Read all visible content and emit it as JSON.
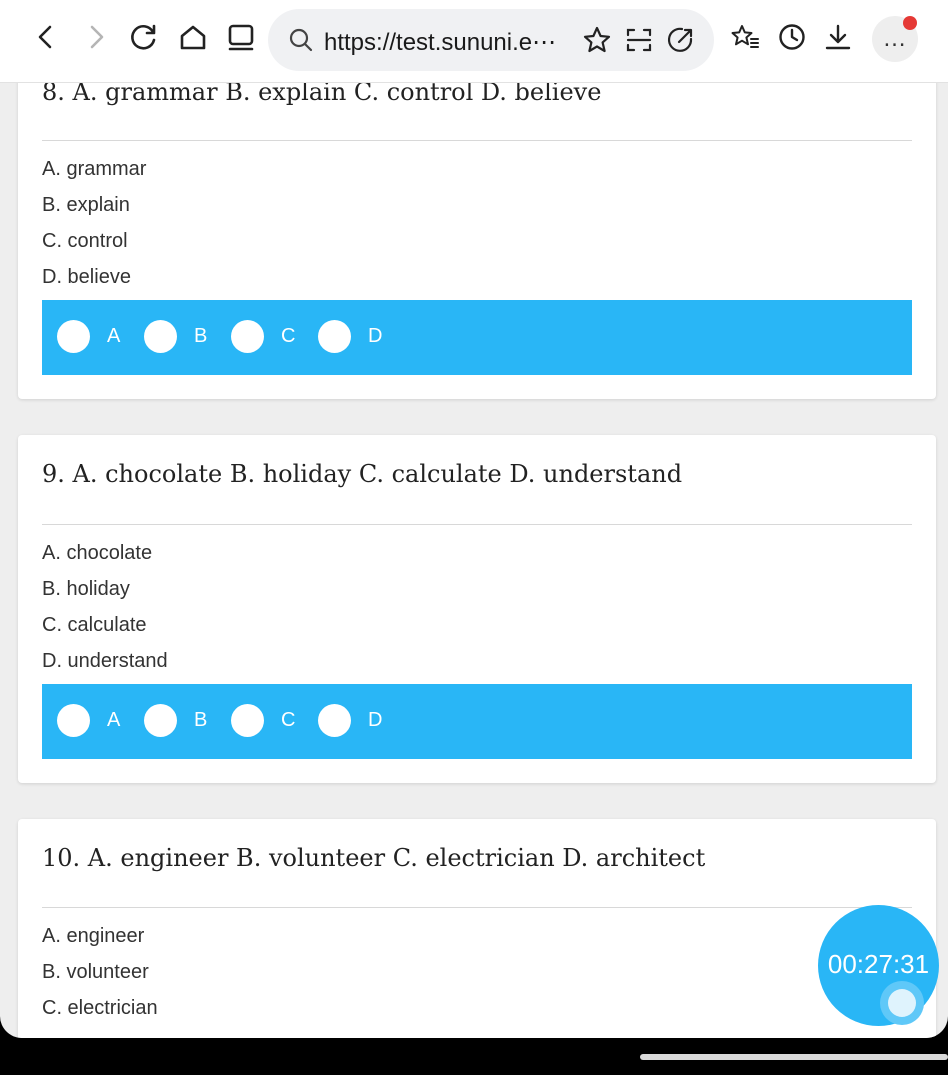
{
  "browser": {
    "url": "https://test.sununi.e⋯",
    "more_label": "…"
  },
  "questions": [
    {
      "title": "8. A. grammar B. explain C. control D. believe",
      "options": [
        "A. grammar",
        "B. explain",
        "C. control",
        "D. believe"
      ],
      "choices": [
        "A",
        "B",
        "C",
        "D"
      ]
    },
    {
      "title": "9. A. chocolate B. holiday C. calculate D. understand",
      "options": [
        "A. chocolate",
        "B. holiday",
        "C. calculate",
        "D. understand"
      ],
      "choices": [
        "A",
        "B",
        "C",
        "D"
      ]
    },
    {
      "title": "10. A. engineer B. volunteer C. electrician D. architect",
      "options": [
        "A. engineer",
        "B. volunteer",
        "C. electrician"
      ],
      "choices": []
    }
  ],
  "timer": {
    "value": "00:27:31"
  },
  "colors": {
    "accent": "#29b6f6",
    "notification_dot": "#e53935"
  }
}
